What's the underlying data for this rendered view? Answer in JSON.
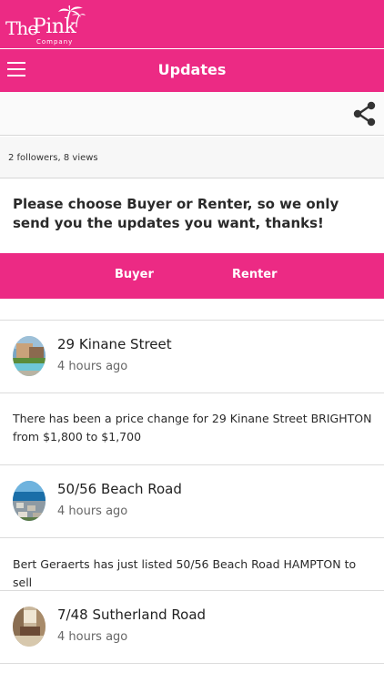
{
  "brand": {
    "logo_the": "The",
    "logo_pink": "Pink",
    "logo_company": "Company"
  },
  "header": {
    "title": "Updates",
    "menu_icon": "hamburger-icon",
    "share_icon": "share-icon"
  },
  "stats": {
    "text": "2 followers, 8 views"
  },
  "prompt": {
    "text": "Please choose Buyer or Renter, so we only send you the updates you want, thanks!"
  },
  "choices": {
    "buyer": "Buyer",
    "renter": "Renter"
  },
  "updates": [
    {
      "address": "29 Kinane Street",
      "time": "4 hours ago",
      "message": "There has been a price change for 29 Kinane Street BRIGHTON from $1,800 to $1,700"
    },
    {
      "address": "50/56 Beach Road",
      "time": "4 hours ago",
      "message": "Bert Geraerts has just listed 50/56 Beach Road HAMPTON to sell"
    },
    {
      "address": "7/48 Sutherland Road",
      "time": "4 hours ago",
      "message": ""
    }
  ],
  "colors": {
    "accent": "#ec2a84",
    "background": "#ffffff"
  }
}
